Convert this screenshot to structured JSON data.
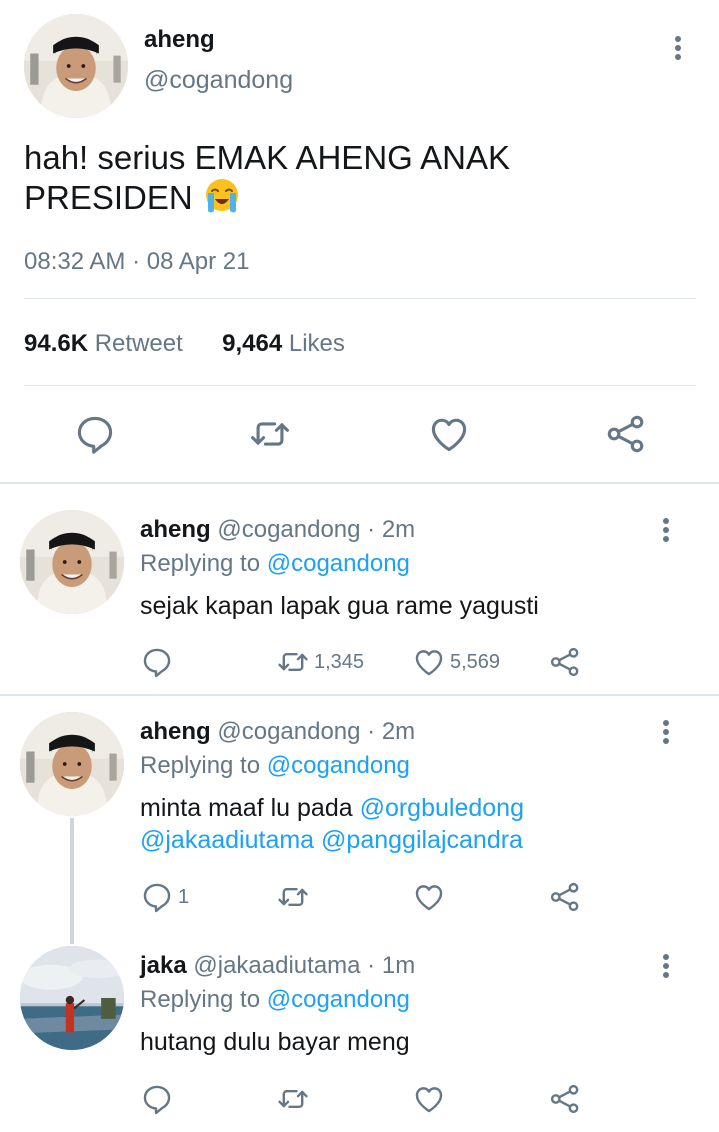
{
  "main_tweet": {
    "name": "aheng",
    "handle": "@cogandong",
    "text": "hah! serius EMAK AHENG ANAK PRESIDEN",
    "emoji": "loudly-crying-face",
    "timestamp": "08:32 AM · 08 Apr 21",
    "retweet_count": "94.6K",
    "retweet_label": "Retweet",
    "like_count": "9,464",
    "like_label": "Likes"
  },
  "replies": [
    {
      "name": "aheng",
      "handle_time": "@cogandong · 2m",
      "replying_prefix": "Replying to",
      "replying_to": "@cogandong",
      "text_line1": "sejak kapan lapak gua rame yagusti",
      "reply_count": "",
      "retweet_count": "1,345",
      "like_count": "5,569"
    },
    {
      "name": "aheng",
      "handle_time": "@cogandong · 2m",
      "replying_prefix": "Replying to",
      "replying_to": "@cogandong",
      "text_prefix": "minta maaf lu pada",
      "mention1": "@orgbuledong",
      "mention2": "@jakaadiutama",
      "mention3": "@panggilajcandra",
      "reply_count": "1",
      "retweet_count": "",
      "like_count": ""
    },
    {
      "name": "jaka",
      "handle_time": "@jakaadiutama · 1m",
      "replying_prefix": "Replying to",
      "replying_to": "@cogandong",
      "text_line1": "hutang dulu bayar meng",
      "reply_count": "",
      "retweet_count": "",
      "like_count": ""
    }
  ],
  "colors": {
    "text": "#14171a",
    "muted": "#657786",
    "link": "#1da1f2",
    "divider": "#e1e8ed"
  }
}
